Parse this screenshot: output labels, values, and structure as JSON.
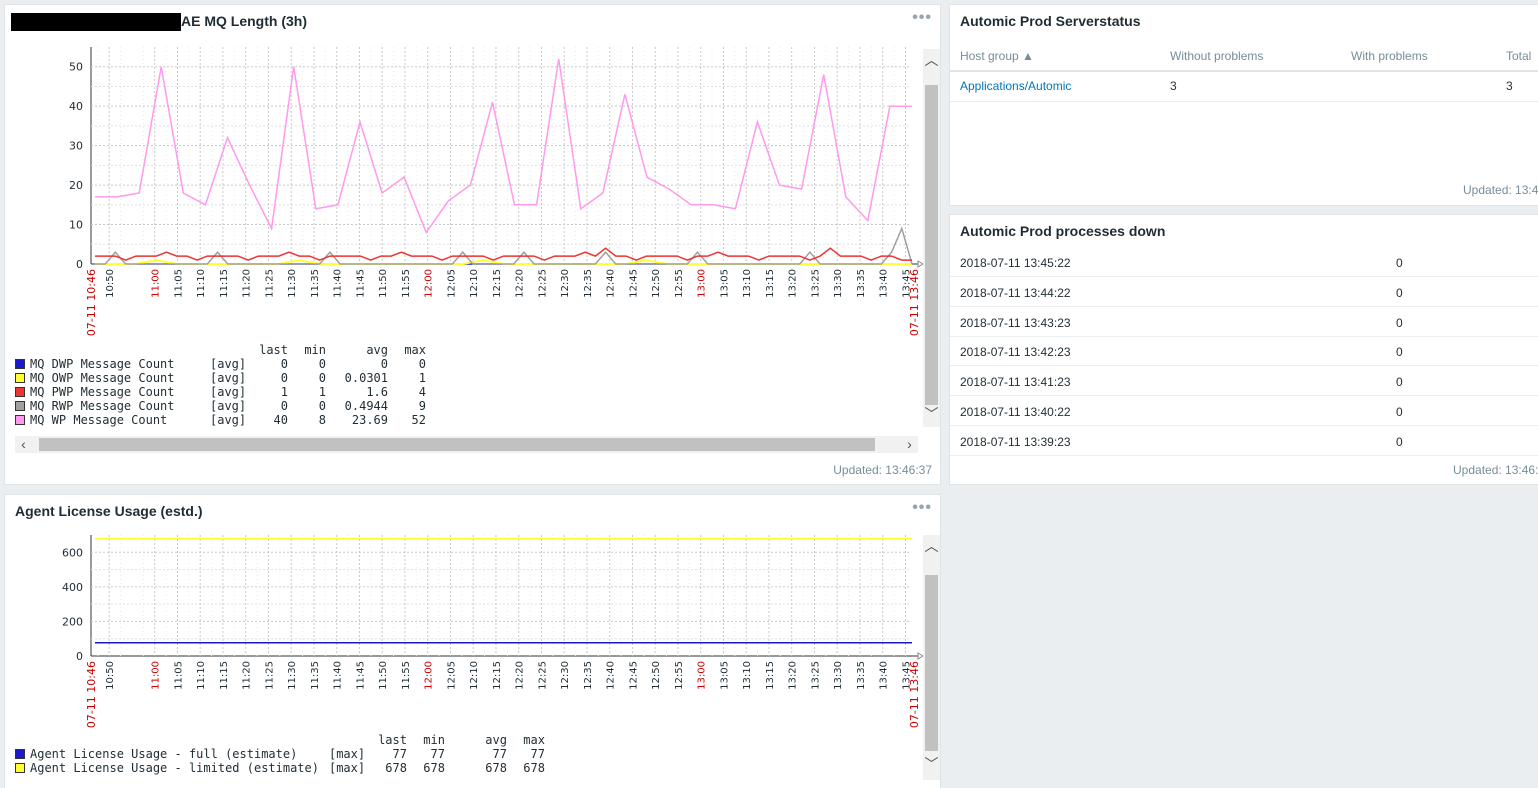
{
  "mq_widget": {
    "title": "AE MQ Length (3h)",
    "menu_icon": "ellipsis-icon",
    "updated": "Updated: 13:46:37",
    "y_ticks": [
      "0",
      "10",
      "20",
      "30",
      "40",
      "50"
    ],
    "x_start_label": "07-11 10:46",
    "x_end_label": "07-11 13:46",
    "legend_headers": [
      "last",
      "min",
      "avg",
      "max"
    ],
    "legend": [
      {
        "name": "MQ DWP Message Count",
        "func": "[avg]",
        "last": "0",
        "min": "0",
        "avg": "0",
        "max": "0",
        "color": "#1a1acc"
      },
      {
        "name": "MQ OWP Message Count",
        "func": "[avg]",
        "last": "0",
        "min": "0",
        "avg": "0.0301",
        "max": "1",
        "color": "#ffff33"
      },
      {
        "name": "MQ PWP Message Count",
        "func": "[avg]",
        "last": "1",
        "min": "1",
        "avg": "1.6",
        "max": "4",
        "color": "#ee3333"
      },
      {
        "name": "MQ RWP Message Count",
        "func": "[avg]",
        "last": "0",
        "min": "0",
        "avg": "0.4944",
        "max": "9",
        "color": "#a0a0a0"
      },
      {
        "name": "MQ WP Message Count",
        "func": "[avg]",
        "last": "40",
        "min": "8",
        "avg": "23.69",
        "max": "52",
        "color": "#ff99ee"
      }
    ]
  },
  "x_ticks": [
    "10:50",
    "11:00",
    "11:05",
    "11:10",
    "11:15",
    "11:20",
    "11:25",
    "11:30",
    "11:35",
    "11:40",
    "11:45",
    "11:50",
    "11:55",
    "12:00",
    "12:05",
    "12:10",
    "12:15",
    "12:20",
    "12:25",
    "12:30",
    "12:35",
    "12:40",
    "12:45",
    "12:50",
    "12:55",
    "13:00",
    "13:05",
    "13:10",
    "13:15",
    "13:20",
    "13:25",
    "13:30",
    "13:35",
    "13:40",
    "13:45"
  ],
  "license_widget": {
    "title": "Agent License Usage (estd.)",
    "menu_icon": "ellipsis-icon",
    "y_ticks": [
      "0",
      "200",
      "400",
      "600"
    ],
    "x_start_label": "07-11 10:46",
    "x_end_label": "07-11 13:46",
    "legend_headers": [
      "last",
      "min",
      "avg",
      "max"
    ],
    "legend": [
      {
        "name": "Agent License Usage - full (estimate)",
        "func": "[max]",
        "last": "77",
        "min": "77",
        "avg": "77",
        "max": "77",
        "color": "#1a1acc"
      },
      {
        "name": "Agent License Usage - limited (estimate)",
        "func": "[max]",
        "last": "678",
        "min": "678",
        "avg": "678",
        "max": "678",
        "color": "#ffff33"
      }
    ]
  },
  "serverstatus_widget": {
    "title": "Automic Prod Serverstatus",
    "headers": [
      "Host group ▲",
      "Without problems",
      "With problems",
      "Total"
    ],
    "rows": [
      {
        "group": "Applications/Automic",
        "without": "3",
        "with": "",
        "total": "3"
      }
    ],
    "updated": "Updated: 13:4"
  },
  "processes_widget": {
    "title": "Automic Prod processes down",
    "rows": [
      {
        "time": "2018-07-11 13:45:22",
        "value": "0"
      },
      {
        "time": "2018-07-11 13:44:22",
        "value": "0"
      },
      {
        "time": "2018-07-11 13:43:23",
        "value": "0"
      },
      {
        "time": "2018-07-11 13:42:23",
        "value": "0"
      },
      {
        "time": "2018-07-11 13:41:23",
        "value": "0"
      },
      {
        "time": "2018-07-11 13:40:22",
        "value": "0"
      },
      {
        "time": "2018-07-11 13:39:23",
        "value": "0"
      }
    ],
    "updated": "Updated: 13:46:"
  },
  "chart_data": [
    {
      "type": "line",
      "title": "AE MQ Length (3h)",
      "ylim": [
        0,
        55
      ],
      "x_range": [
        "07-11 10:46",
        "07-11 13:46"
      ],
      "grid": true,
      "series": [
        {
          "name": "MQ WP Message Count",
          "color": "#ff99ee",
          "values": [
            17,
            17,
            18,
            50,
            18,
            15,
            32,
            20,
            9,
            50,
            14,
            15,
            36,
            18,
            22,
            8,
            16,
            20,
            41,
            15,
            15,
            52,
            14,
            18,
            43,
            22,
            19,
            15,
            15,
            14,
            36,
            20,
            19,
            48,
            17,
            11,
            40,
            40
          ]
        },
        {
          "name": "MQ PWP Message Count",
          "color": "#ee3333",
          "values": [
            2,
            2,
            2,
            1,
            2,
            2,
            2,
            3,
            2,
            2,
            1,
            2,
            2,
            2,
            2,
            1,
            2,
            2,
            2,
            3,
            2,
            2,
            1,
            2,
            2,
            2,
            2,
            1,
            2,
            2,
            3,
            2,
            2,
            2,
            1,
            2,
            2,
            2,
            2,
            1,
            2,
            2,
            2,
            2,
            1,
            2,
            2,
            2,
            3,
            2,
            4,
            2,
            2,
            1,
            2,
            2,
            2,
            2,
            1,
            2,
            2,
            3,
            2,
            2,
            2,
            1,
            2,
            2,
            2,
            2,
            1,
            2,
            4,
            2,
            2,
            2,
            1,
            2,
            2,
            1,
            1
          ]
        },
        {
          "name": "MQ RWP Message Count",
          "color": "#a0a0a0",
          "values": [
            0,
            0,
            3,
            0,
            0,
            0,
            0,
            0,
            0,
            0,
            0,
            0,
            3,
            0,
            0,
            0,
            0,
            0,
            0,
            0,
            0,
            0,
            0,
            3,
            0,
            0,
            0,
            0,
            0,
            0,
            0,
            0,
            0,
            0,
            0,
            0,
            3,
            0,
            0,
            0,
            0,
            0,
            3,
            0,
            0,
            0,
            0,
            0,
            0,
            0,
            3,
            0,
            0,
            0,
            0,
            0,
            0,
            0,
            0,
            3,
            0,
            0,
            0,
            0,
            0,
            0,
            0,
            0,
            0,
            0,
            3,
            0,
            0,
            0,
            0,
            0,
            0,
            0,
            3,
            9,
            0
          ]
        },
        {
          "name": "MQ OWP Message Count",
          "color": "#ffff33",
          "values": [
            0,
            0,
            0,
            1,
            0,
            0,
            0,
            0,
            0,
            0,
            1,
            0,
            0,
            0,
            0,
            0,
            0,
            0,
            0,
            1,
            0,
            0,
            0,
            0,
            0,
            0,
            0,
            1,
            0,
            0,
            0,
            0,
            0,
            0,
            0,
            0,
            0,
            0,
            0,
            0,
            0
          ]
        },
        {
          "name": "MQ DWP Message Count",
          "color": "#1a1acc",
          "values": [
            0,
            0,
            0,
            0,
            0,
            0,
            0,
            0,
            0,
            0,
            0,
            0,
            0,
            0,
            0,
            0,
            0,
            0,
            0,
            0,
            0,
            0,
            0,
            0,
            0,
            0,
            0,
            0,
            0,
            0,
            0,
            0,
            0,
            0,
            0,
            0,
            0,
            0,
            0,
            0,
            0
          ]
        }
      ]
    },
    {
      "type": "line",
      "title": "Agent License Usage (estd.)",
      "ylim": [
        0,
        700
      ],
      "x_range": [
        "07-11 10:46",
        "07-11 13:46"
      ],
      "grid": true,
      "series": [
        {
          "name": "Agent License Usage - limited (estimate)",
          "color": "#ffff33",
          "values": [
            678,
            678
          ]
        },
        {
          "name": "Agent License Usage - full (estimate)",
          "color": "#1a1acc",
          "values": [
            77,
            77
          ]
        }
      ]
    }
  ]
}
